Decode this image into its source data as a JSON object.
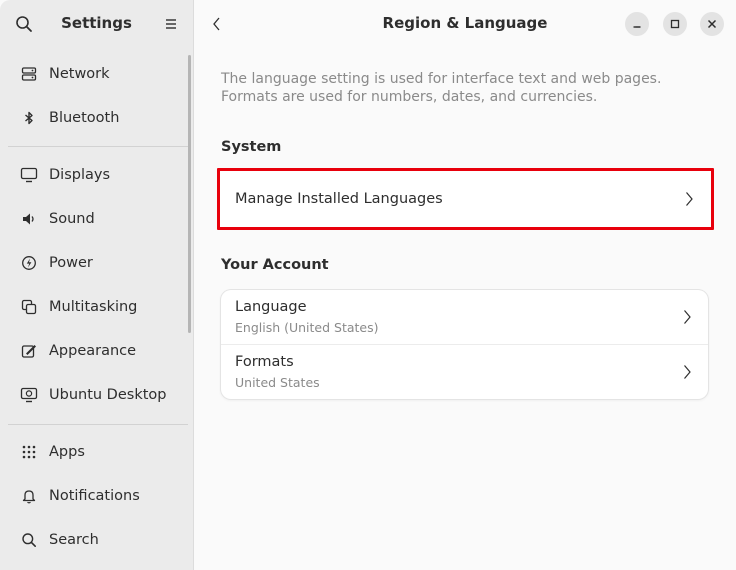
{
  "sidebar": {
    "title": "Settings",
    "items": [
      {
        "label": "Network",
        "icon": "network-icon"
      },
      {
        "label": "Bluetooth",
        "icon": "bluetooth-icon"
      },
      {
        "label": "Displays",
        "icon": "display-icon"
      },
      {
        "label": "Sound",
        "icon": "sound-icon"
      },
      {
        "label": "Power",
        "icon": "power-icon"
      },
      {
        "label": "Multitasking",
        "icon": "multitasking-icon"
      },
      {
        "label": "Appearance",
        "icon": "appearance-icon"
      },
      {
        "label": "Ubuntu Desktop",
        "icon": "ubuntu-desktop-icon"
      },
      {
        "label": "Apps",
        "icon": "apps-grid-icon"
      },
      {
        "label": "Notifications",
        "icon": "bell-icon"
      },
      {
        "label": "Search",
        "icon": "search-icon"
      }
    ]
  },
  "main": {
    "title": "Region & Language",
    "description": "The language setting is used for interface text and web pages. Formats are used for numbers, dates, and currencies.",
    "system": {
      "title": "System",
      "manage_label": "Manage Installed Languages"
    },
    "account": {
      "title": "Your Account",
      "rows": [
        {
          "label": "Language",
          "value": "English (United States)"
        },
        {
          "label": "Formats",
          "value": "United States"
        }
      ]
    }
  },
  "colors": {
    "highlight": "#e8000c",
    "sidebar_bg": "#ebebeb",
    "main_bg": "#fafafa"
  }
}
